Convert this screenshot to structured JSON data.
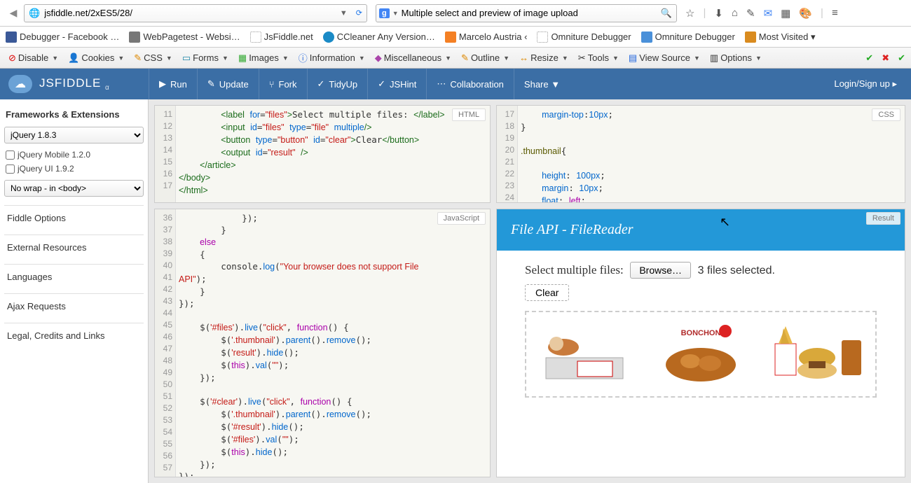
{
  "browser": {
    "url": "jsfiddle.net/2xES5/28/",
    "search": "Multiple select and preview of image upload",
    "icons": [
      "★",
      "|",
      "↓",
      "⌂",
      "✎",
      "✉",
      "◧",
      "⬚",
      "≡"
    ]
  },
  "bookmarks": [
    {
      "label": "Debugger - Facebook …",
      "color": "#3b5998"
    },
    {
      "label": "WebPagetest - Websi…",
      "color": "#777"
    },
    {
      "label": "JsFiddle.net",
      "color": "#ccc"
    },
    {
      "label": "CCleaner Any Version…",
      "color": "#1a8ac6"
    },
    {
      "label": "Marcelo Austria ‹",
      "color": "#f48024"
    },
    {
      "label": "Omniture Debugger",
      "color": "#ccc"
    },
    {
      "label": "Omniture Debugger",
      "color": "#4a90d9"
    },
    {
      "label": "Most Visited ▾",
      "color": "#d98b1f"
    }
  ],
  "devtools": [
    "Disable",
    "Cookies",
    "CSS",
    "Forms",
    "Images",
    "Information",
    "Miscellaneous",
    "Outline",
    "Resize",
    "Tools",
    "View Source",
    "Options"
  ],
  "jsfiddle": {
    "logo": "JSFIDDLE",
    "actions": [
      {
        "icon": "▶",
        "label": "Run"
      },
      {
        "icon": "✎",
        "label": "Update"
      },
      {
        "icon": "⑂",
        "label": "Fork"
      },
      {
        "icon": "✓",
        "label": "TidyUp"
      },
      {
        "icon": "✓",
        "label": "JSHint"
      },
      {
        "icon": "⋯",
        "label": "Collaboration"
      },
      {
        "icon": "",
        "label": "Share ▼"
      }
    ],
    "login": "Login/Sign up ▸"
  },
  "sidebar": {
    "head": "Frameworks & Extensions",
    "lib": "jQuery 1.8.3",
    "ext1": "jQuery Mobile 1.2.0",
    "ext2": "jQuery UI 1.9.2",
    "wrap": "No wrap - in <body>",
    "sections": [
      "Fiddle Options",
      "External Resources",
      "Languages",
      "Ajax Requests",
      "Legal, Credits and Links"
    ]
  },
  "panes": {
    "html_label": "HTML",
    "css_label": "CSS",
    "js_label": "JavaScript",
    "result_label": "Result"
  },
  "html_lines_start": 11,
  "css_lines_start": 17,
  "js_lines_start": 36,
  "result": {
    "title": "File API - FileReader",
    "label": "Select multiple files:",
    "browse": "Browse…",
    "status": "3 files selected.",
    "clear": "Clear"
  }
}
